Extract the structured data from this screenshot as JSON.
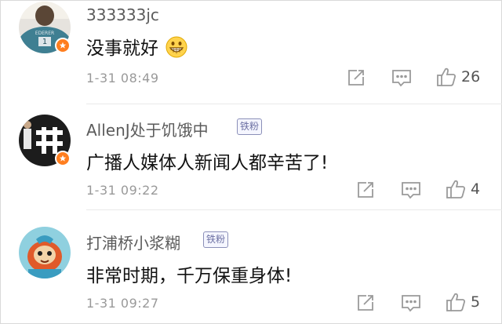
{
  "comments": [
    {
      "username": "333333jc",
      "content": "没事就好",
      "emoji": "grin-emoji",
      "time": "1-31 08:49",
      "likes": "26",
      "verified": true,
      "fan_badge": ""
    },
    {
      "username": "AllenJ处于饥饿中",
      "content": "广播人媒体人新闻人都辛苦了!",
      "time": "1-31 09:22",
      "likes": "4",
      "verified": true,
      "fan_badge": "铁粉"
    },
    {
      "username": "打浦桥小浆糊",
      "content": "非常时期，千万保重身体!",
      "time": "1-31 09:27",
      "likes": "5",
      "verified": false,
      "fan_badge": "铁粉"
    }
  ],
  "colors": {
    "verified_badge": "#ff7e1f",
    "fan_badge_border": "#8b8fb8",
    "icon_gray": "#9a9a9a"
  },
  "icons": [
    "edit-share-icon",
    "comment-icon",
    "thumbs-up-icon",
    "verified-badge-icon"
  ]
}
